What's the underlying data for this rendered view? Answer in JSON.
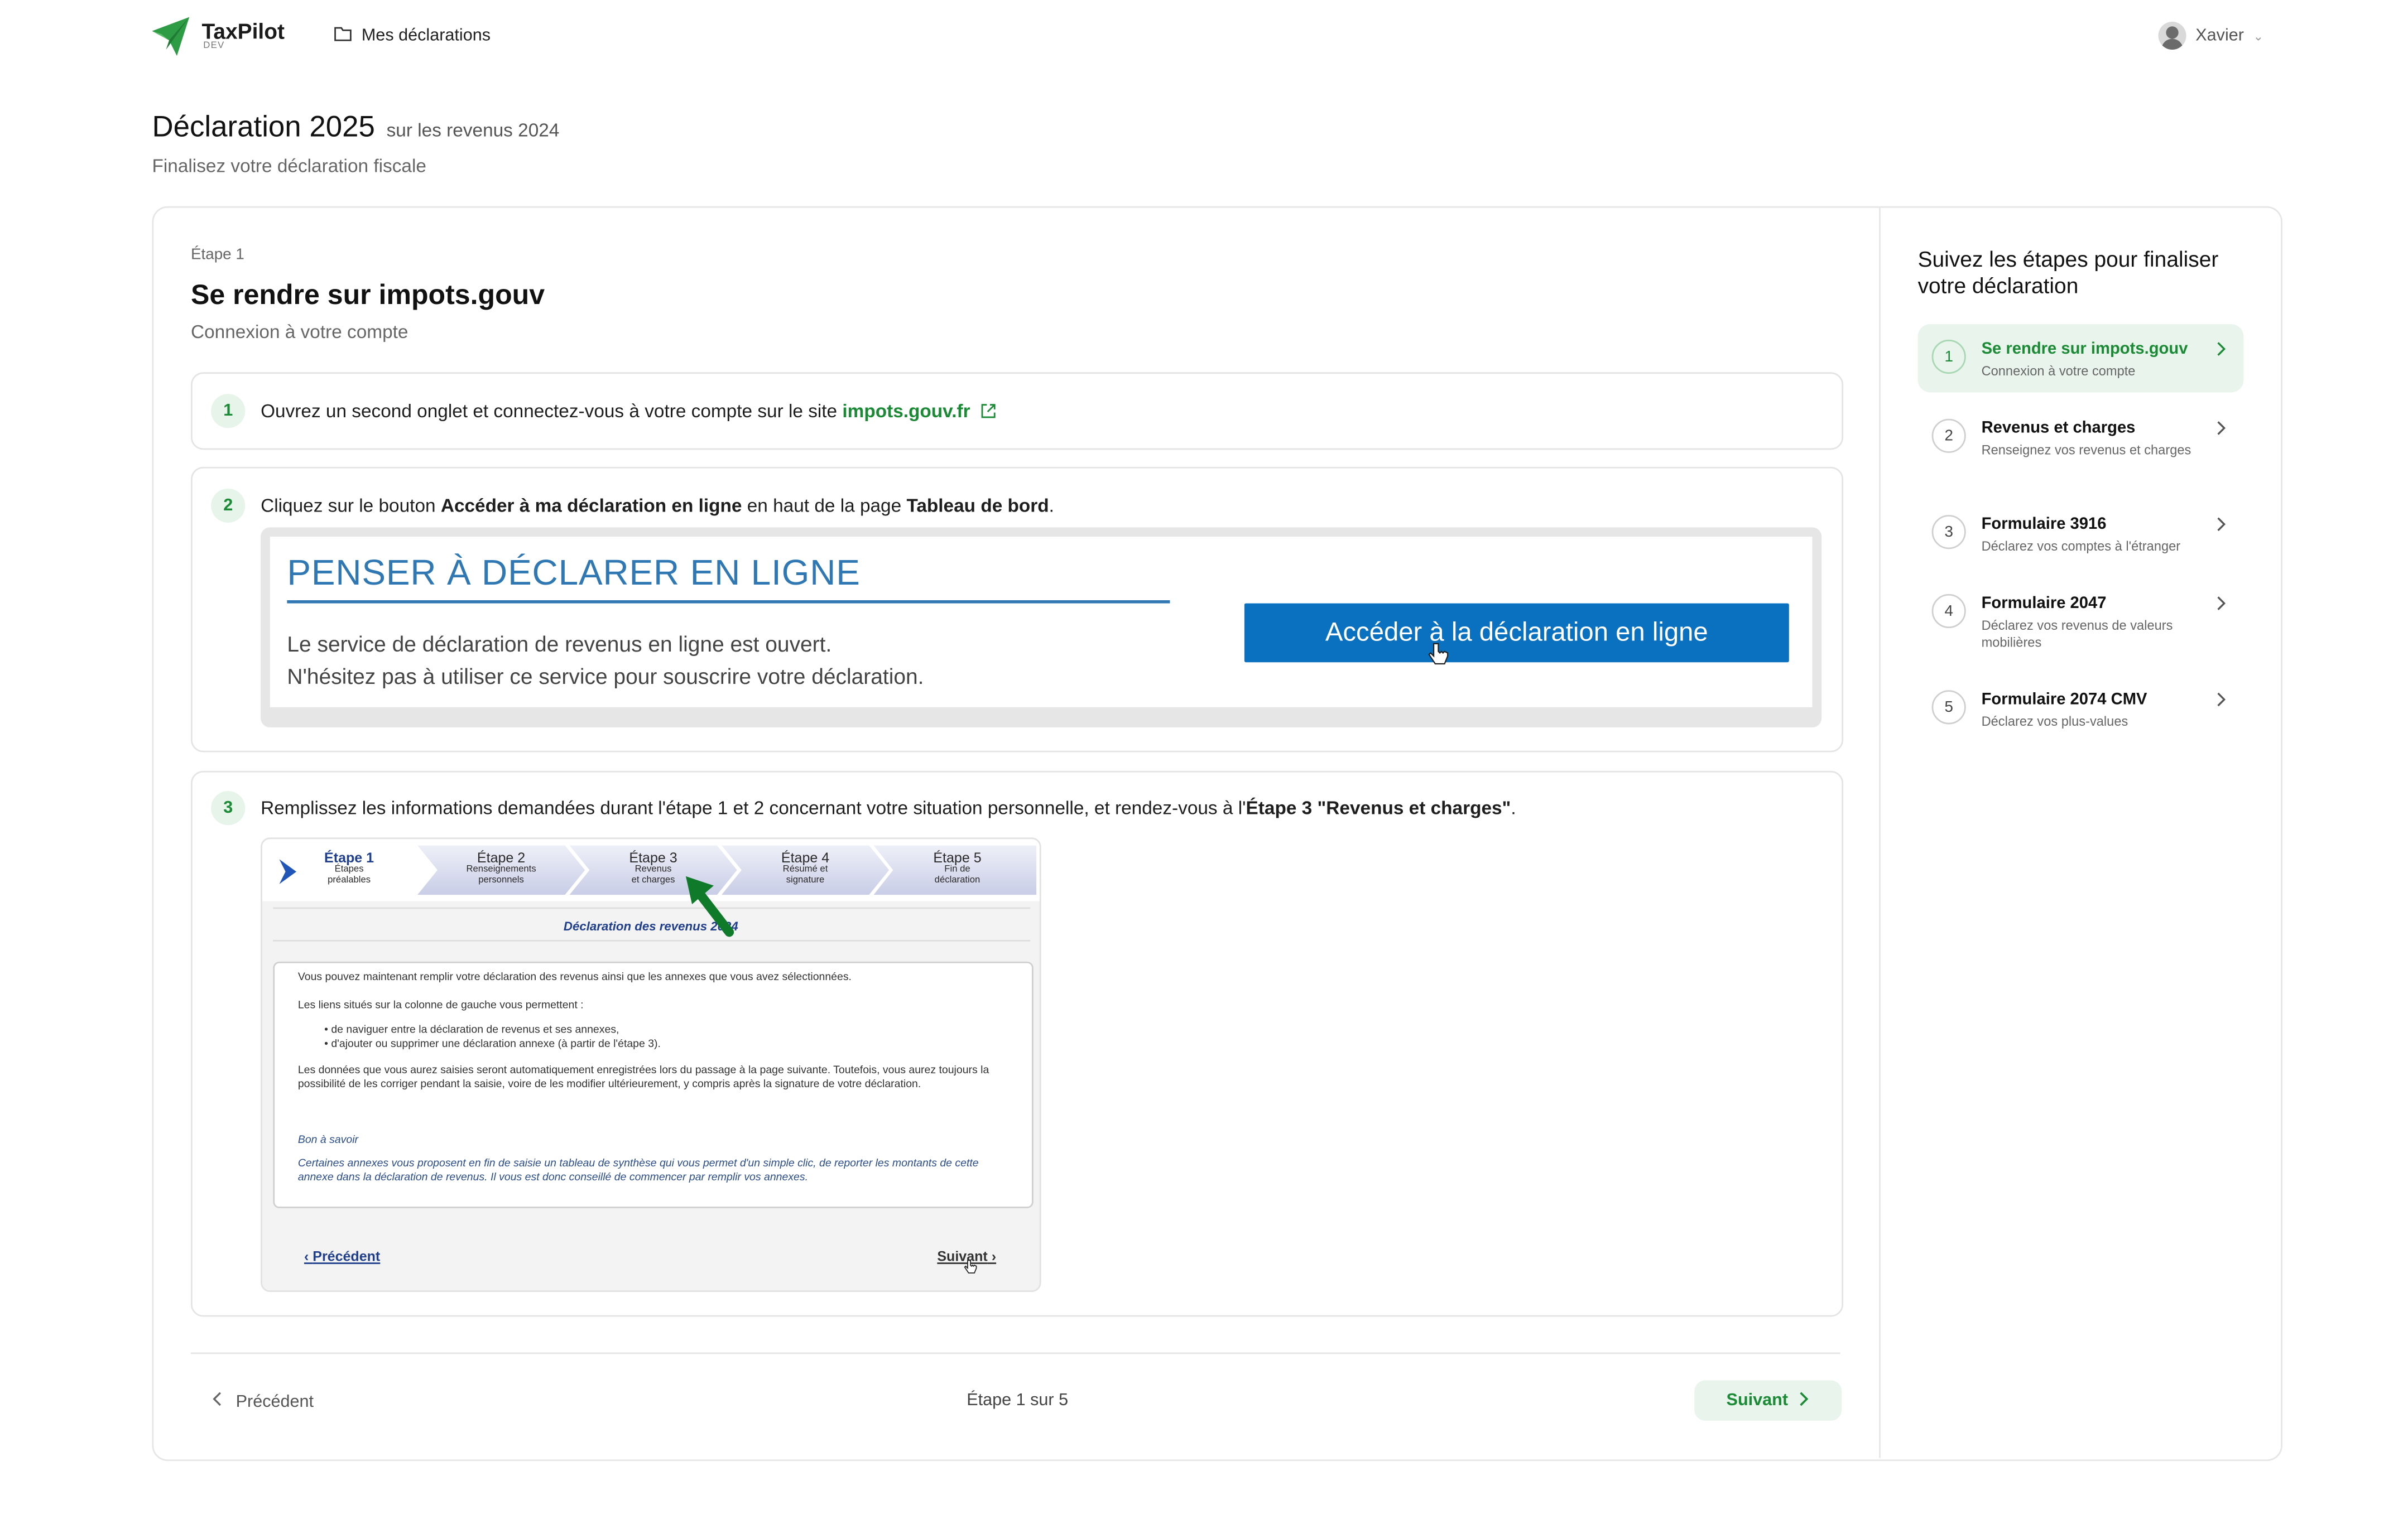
{
  "header": {
    "logo_text": "TaxPilot",
    "logo_sub": "DEV",
    "nav_item": "Mes déclarations",
    "user_name": "Xavier"
  },
  "page": {
    "title": "Déclaration 2025",
    "title_suffix": "sur les revenus 2024",
    "subtitle": "Finalisez votre déclaration fiscale"
  },
  "main": {
    "step_label": "Étape 1",
    "step_title": "Se rendre sur impots.gouv",
    "step_subtitle": "Connexion à votre compte",
    "instructions": [
      {
        "num": "1",
        "text": "Ouvrez un second onglet et connectez-vous à votre compte sur le site ",
        "link": "impots.gouv.fr"
      },
      {
        "num": "2",
        "pre": "Cliquez sur le bouton ",
        "bold1": "Accéder à ma déclaration en ligne",
        "mid": " en haut de la page ",
        "bold2": "Tableau de bord",
        "post": "."
      },
      {
        "num": "3",
        "pre": "Remplissez les informations demandées durant l'étape 1 et 2 concernant votre situation personnelle, et rendez-vous à l'",
        "bold": "Étape 3 \"Revenus et charges\"",
        "post": "."
      }
    ],
    "screenshot1": {
      "title": "PENSER À DÉCLARER EN LIGNE",
      "line1": "Le service de déclaration de revenus en ligne est ouvert.",
      "line2": "N'hésitez pas à utiliser ce service pour souscrire votre déclaration.",
      "button": "Accéder à la déclaration en ligne"
    },
    "screenshot2": {
      "steps": [
        {
          "title": "Étape 1",
          "sub1": "Étapes",
          "sub2": "préalables"
        },
        {
          "title": "Étape 2",
          "sub1": "Renseignements",
          "sub2": "personnels"
        },
        {
          "title": "Étape 3",
          "sub1": "Revenus",
          "sub2": "et charges"
        },
        {
          "title": "Étape 4",
          "sub1": "Résumé et",
          "sub2": "signature"
        },
        {
          "title": "Étape 5",
          "sub1": "Fin de",
          "sub2": "déclaration"
        }
      ],
      "heading": "Déclaration des revenus 2024",
      "p1": "Vous pouvez maintenant remplir votre déclaration des revenus ainsi que les annexes que vous avez sélectionnées.",
      "p2": "Les liens situés sur la colonne de gauche vous permettent :",
      "bullet1": "de naviguer entre la déclaration de revenus et ses annexes,",
      "bullet2": "d'ajouter ou supprimer une déclaration annexe (à partir de l'étape 3).",
      "p3": "Les données que vous aurez saisies seront automatiquement enregistrées lors du passage à la page suivante. Toutefois, vous aurez toujours la possibilité de les corriger pendant la saisie, voire de les modifier ultérieurement, y compris après la signature de votre déclaration.",
      "note_title": "Bon à savoir",
      "note": "Certaines annexes vous proposent en fin de saisie un tableau de synthèse qui vous permet d'un simple clic, de reporter les montants de cette annexe dans la déclaration de revenus. Il vous est donc conseillé de commencer par remplir vos annexes.",
      "prev": "Précédent",
      "next": "Suivant"
    },
    "footer": {
      "prev": "Précédent",
      "progress": "Étape 1 sur 5",
      "next": "Suivant"
    }
  },
  "sidebar": {
    "title": "Suivez les étapes pour finaliser votre déclaration",
    "items": [
      {
        "num": "1",
        "title": "Se rendre sur impots.gouv",
        "sub": "Connexion à votre compte"
      },
      {
        "num": "2",
        "title": "Revenus et charges",
        "sub": "Renseignez vos revenus et charges"
      },
      {
        "num": "3",
        "title": "Formulaire 3916",
        "sub": "Déclarez vos comptes à l'étranger"
      },
      {
        "num": "4",
        "title": "Formulaire 2047",
        "sub": "Déclarez vos revenus de valeurs mobilières"
      },
      {
        "num": "5",
        "title": "Formulaire 2074 CMV",
        "sub": "Déclarez vos plus-values"
      }
    ]
  },
  "colors": {
    "accent": "#1a8a35",
    "accent_bg": "#e9f5ec",
    "impots_blue": "#2f78b4"
  }
}
